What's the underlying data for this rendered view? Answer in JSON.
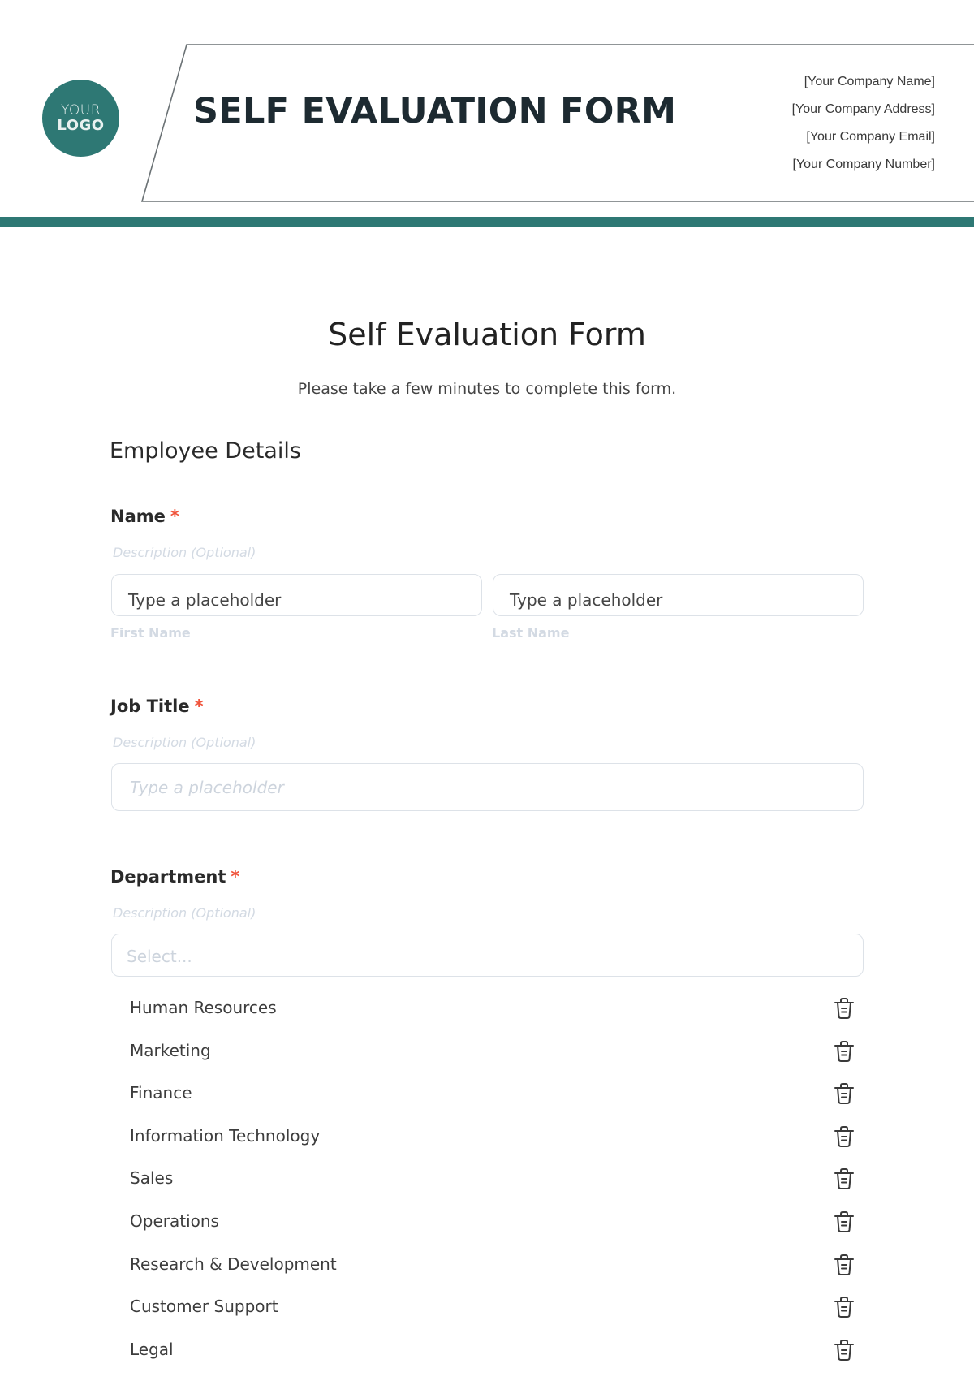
{
  "header": {
    "logo": {
      "line1": "YOUR",
      "line2": "LOGO"
    },
    "title": "SELF EVALUATION FORM",
    "company": {
      "name": "[Your Company Name]",
      "address": "[Your Company Address]",
      "email": "[Your Company Email]",
      "number": "[Your Company Number]"
    },
    "accent_color": "#2e7874"
  },
  "form": {
    "title": "Self Evaluation Form",
    "subtitle": "Please take a few minutes to complete this form.",
    "section_title": "Employee Details",
    "required_marker": "*",
    "fields": {
      "name": {
        "label": "Name",
        "description": "Description (Optional)",
        "first": {
          "value": "Type a placeholder",
          "sublabel": "First Name"
        },
        "last": {
          "value": "Type a placeholder",
          "sublabel": "Last Name"
        }
      },
      "job_title": {
        "label": "Job Title",
        "description": "Description (Optional)",
        "placeholder": "Type a placeholder"
      },
      "department": {
        "label": "Department",
        "description": "Description (Optional)",
        "placeholder": "Select...",
        "options": [
          {
            "label": "Human Resources",
            "icon": "trash-icon"
          },
          {
            "label": "Marketing",
            "icon": "trash-icon"
          },
          {
            "label": "Finance",
            "icon": "trash-icon"
          },
          {
            "label": "Information Technology",
            "icon": "trash-icon"
          },
          {
            "label": "Sales",
            "icon": "trash-icon"
          },
          {
            "label": "Operations",
            "icon": "trash-icon"
          },
          {
            "label": "Research & Development",
            "icon": "trash-icon"
          },
          {
            "label": "Customer Support",
            "icon": "trash-icon"
          },
          {
            "label": "Legal",
            "icon": "trash-icon"
          }
        ]
      }
    }
  }
}
